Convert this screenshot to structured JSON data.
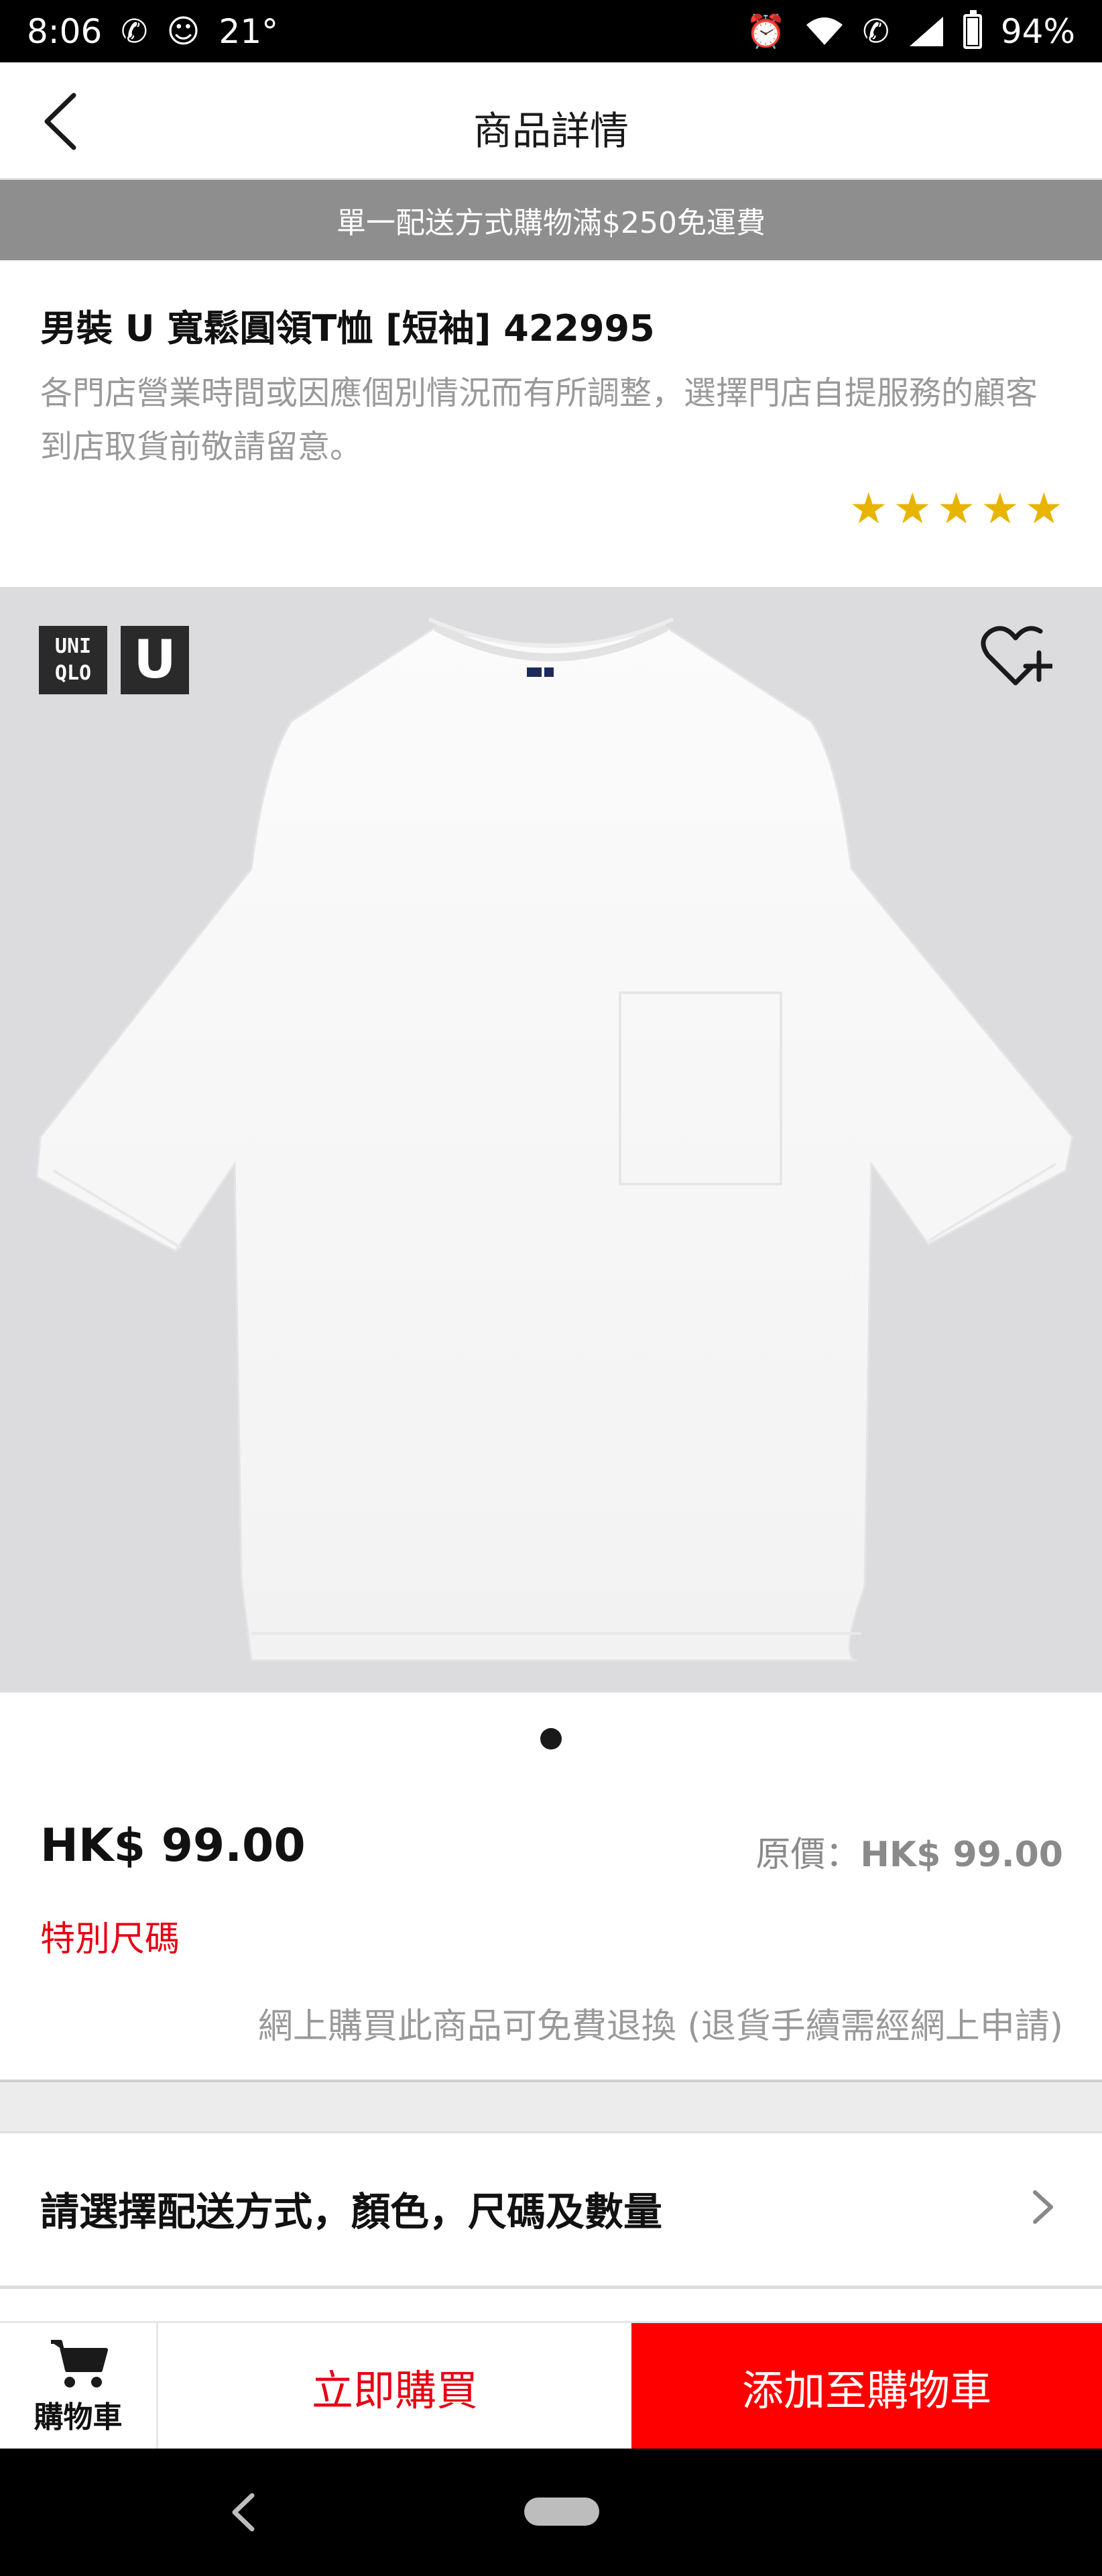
{
  "status_bar": {
    "time": "8:06",
    "temperature": "21°",
    "battery": "94%"
  },
  "header": {
    "title": "商品詳情"
  },
  "promo": {
    "text": "單一配送方式購物滿$250免運費"
  },
  "product": {
    "name": "男裝 U 寬鬆圓領T恤 [短袖] 422995",
    "notice": "各門店營業時間或因應個別情況而有所調整，選擇門店自提服務的顧客到店取貨前敬請留意。",
    "rating_stars": 5,
    "brand_logo_text": "UNI QLO",
    "brand_u_text": "U",
    "image_count": 1,
    "current_image": 1
  },
  "pricing": {
    "price": "HK$ 99.00",
    "original_label": "原價：",
    "original_price": "HK$ 99.00",
    "special_size": "特別尺碼",
    "return_note": "網上購買此商品可免費退換 (退貨手續需經網上申請)"
  },
  "selector": {
    "label": "請選擇配送方式，顏色，尺碼及數量"
  },
  "actions": {
    "cart_label": "購物車",
    "buy_now": "立即購買",
    "add_to_cart": "添加至購物車"
  },
  "colors": {
    "accent_red": "#e60012",
    "add_cart_bg": "#ff0000",
    "promo_bg": "#8e8e8e",
    "star": "#e8b400",
    "image_bg": "#dcdcde"
  }
}
